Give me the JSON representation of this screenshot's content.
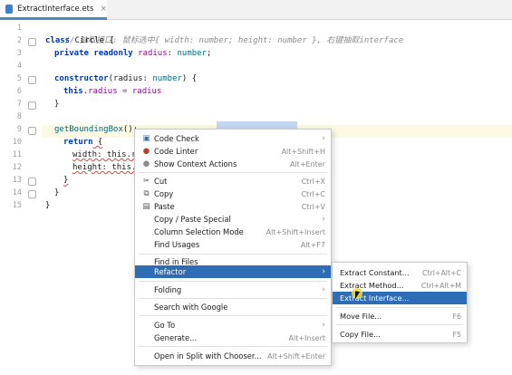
{
  "tab": {
    "label": "ExtractInterface.ets",
    "close": "×"
  },
  "gutter": {
    "lines": [
      "1",
      "2",
      "3",
      "4",
      "5",
      "6",
      "7",
      "8",
      "9",
      "10",
      "11",
      "12",
      "13",
      "14",
      "15"
    ]
  },
  "code": {
    "l1_comment": "// 抽取接口: 鼠标选中{ width: number; height: number }, 右键抽取interface",
    "l2_kw": "class",
    "l2_name": " Circle {",
    "l3_kw": "private readonly",
    "l3_field": " radius",
    "l3_rest": ": ",
    "l3_type": "number",
    "l3_end": ";",
    "l5_kw": "constructor",
    "l5_rest": "(radius: ",
    "l5_type": "number",
    "l5_end": ") {",
    "l6_kw": "this",
    "l6_rest": ".radius = radius",
    "l7": "}",
    "l9_fn": "getBoundingBox",
    "l9_rest": "():",
    "l10_kw": "return",
    "l10_rest": " {",
    "l11_text": "width: this.r",
    "l12_text": "height: this.",
    "l13": "}",
    "l14": "}",
    "l15": "}"
  },
  "context_menu": {
    "items": [
      {
        "icon": "code-check-icon",
        "glyph": "▣",
        "label": "Code Check",
        "shortcut": "",
        "submenu": true
      },
      {
        "icon": "code-linter-icon",
        "glyph": "●",
        "label": "Code Linter",
        "shortcut": "Alt+Shift+H",
        "submenu": false
      },
      {
        "icon": "bulb-icon",
        "glyph": "●",
        "label": "Show Context Actions",
        "shortcut": "Alt+Enter",
        "submenu": false
      },
      {
        "icon": "scissors-icon",
        "glyph": "✂",
        "label": "Cut",
        "shortcut": "Ctrl+X",
        "submenu": false
      },
      {
        "icon": "copy-icon",
        "glyph": "⧉",
        "label": "Copy",
        "shortcut": "Ctrl+C",
        "submenu": false
      },
      {
        "icon": "paste-icon",
        "glyph": "▤",
        "label": "Paste",
        "shortcut": "Ctrl+V",
        "submenu": false
      },
      {
        "icon": "",
        "glyph": "",
        "label": "Copy / Paste Special",
        "shortcut": "",
        "submenu": true
      },
      {
        "icon": "",
        "glyph": "",
        "label": "Column Selection Mode",
        "shortcut": "Alt+Shift+Insert",
        "submenu": false
      },
      {
        "icon": "",
        "glyph": "",
        "label": "Find Usages",
        "shortcut": "Alt+F7",
        "submenu": false
      },
      {
        "icon": "",
        "glyph": "",
        "label": "Find in Files",
        "shortcut": "",
        "submenu": false
      },
      {
        "icon": "",
        "glyph": "",
        "label": "Refactor",
        "shortcut": "",
        "submenu": true
      },
      {
        "icon": "",
        "glyph": "",
        "label": "Folding",
        "shortcut": "",
        "submenu": true
      },
      {
        "icon": "",
        "glyph": "",
        "label": "Search with Google",
        "shortcut": "",
        "submenu": false
      },
      {
        "icon": "",
        "glyph": "",
        "label": "Go To",
        "shortcut": "",
        "submenu": true
      },
      {
        "icon": "",
        "glyph": "",
        "label": "Generate...",
        "shortcut": "Alt+Insert",
        "submenu": false
      },
      {
        "icon": "",
        "glyph": "",
        "label": "Open in Split with Chooser...",
        "shortcut": "Alt+Shift+Enter",
        "submenu": false
      }
    ]
  },
  "refactor_submenu": {
    "items": [
      {
        "label": "Extract Constant...",
        "shortcut": "Ctrl+Alt+C"
      },
      {
        "label": "Extract Method...",
        "shortcut": "Ctrl+Alt+M"
      },
      {
        "label": "Extract Interface...",
        "shortcut": ""
      },
      {
        "label": "Move File...",
        "shortcut": "F6"
      },
      {
        "label": "Copy File...",
        "shortcut": "F5"
      }
    ]
  },
  "colors": {
    "accent": "#2e6db5",
    "keyword": "#0033b3",
    "comment": "#8c8c8c",
    "field": "#871094"
  }
}
